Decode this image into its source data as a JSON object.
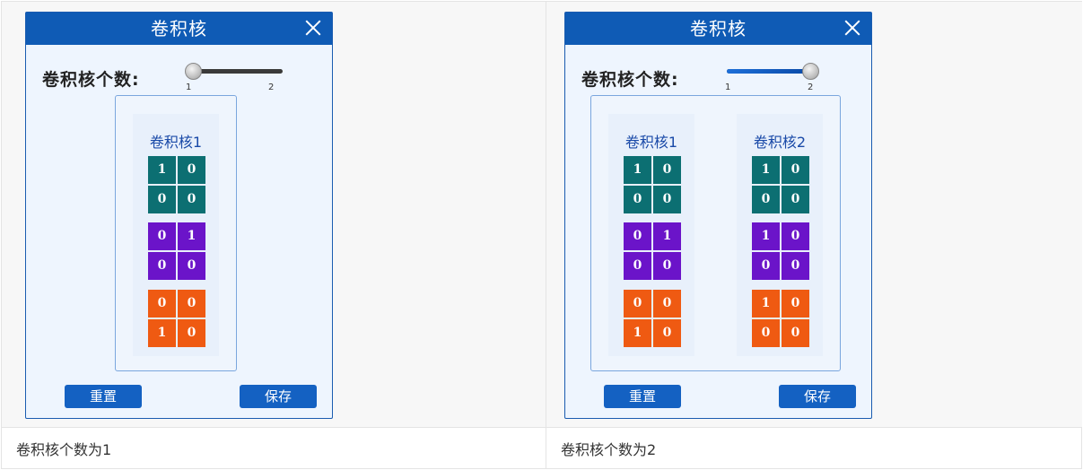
{
  "dialog_title": "卷积核",
  "count_label": "卷积核个数:",
  "slider": {
    "min_label": "1",
    "max_label": "2"
  },
  "buttons": {
    "reset": "重置",
    "save": "保存"
  },
  "captions": [
    "卷积核个数为1",
    "卷积核个数为2"
  ],
  "colors": {
    "title_bar": "#0f5bb5",
    "teal": "#0c6f72",
    "purple": "#6b14c9",
    "orange": "#ef5a12",
    "button": "#1461c2"
  },
  "dialogs": [
    {
      "slider_value": 1,
      "kernels": [
        {
          "title": "卷积核1",
          "teal": [
            "1",
            "0",
            "0",
            "0"
          ],
          "purple": [
            "0",
            "1",
            "0",
            "0"
          ],
          "orange": [
            "0",
            "0",
            "1",
            "0"
          ]
        }
      ]
    },
    {
      "slider_value": 2,
      "kernels": [
        {
          "title": "卷积核1",
          "teal": [
            "1",
            "0",
            "0",
            "0"
          ],
          "purple": [
            "0",
            "1",
            "0",
            "0"
          ],
          "orange": [
            "0",
            "0",
            "1",
            "0"
          ]
        },
        {
          "title": "卷积核2",
          "teal": [
            "1",
            "0",
            "0",
            "0"
          ],
          "purple": [
            "1",
            "0",
            "0",
            "0"
          ],
          "orange": [
            "1",
            "0",
            "0",
            "0"
          ]
        }
      ]
    }
  ]
}
